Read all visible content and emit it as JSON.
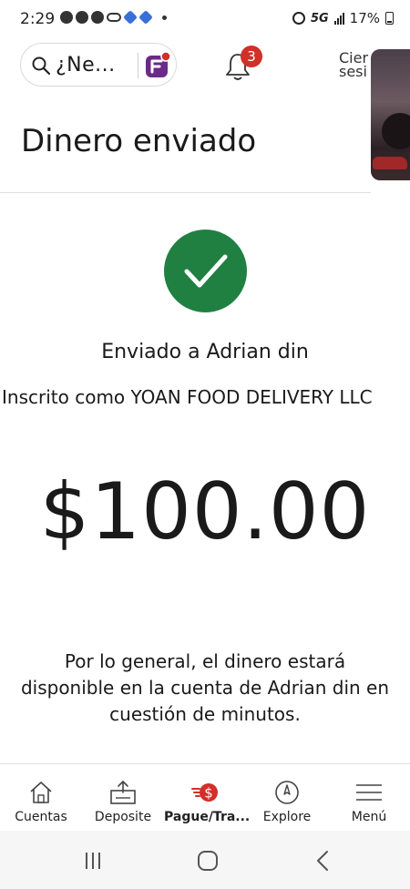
{
  "status_bar": {
    "time": "2:29",
    "network": "5G",
    "battery": "17%"
  },
  "header": {
    "search_text": "¿Ne...",
    "notification_count": "3",
    "logout_label_line1": "Cier",
    "logout_label_line2": "sesi"
  },
  "page": {
    "title": "Dinero enviado"
  },
  "confirmation": {
    "sent_to": "Enviado a Adrian din",
    "enrolled_as": "Inscrito como YOAN FOOD DELIVERY LLC",
    "amount": "$100.00",
    "info": "Por lo general, el dinero estará disponible en la cuenta de Adrian din en cuestión de minutos.",
    "accent_color": "#1f8042"
  },
  "bottom_nav": {
    "items": [
      {
        "label": "Cuentas",
        "icon": "house-icon"
      },
      {
        "label": "Deposite",
        "icon": "deposit-icon"
      },
      {
        "label": "Pague/Tra...",
        "icon": "pay-transfer-icon",
        "active": true
      },
      {
        "label": "Explore",
        "icon": "compass-icon"
      },
      {
        "label": "Menú",
        "icon": "hamburger-menu-icon"
      }
    ],
    "active_color": "#d03027"
  }
}
